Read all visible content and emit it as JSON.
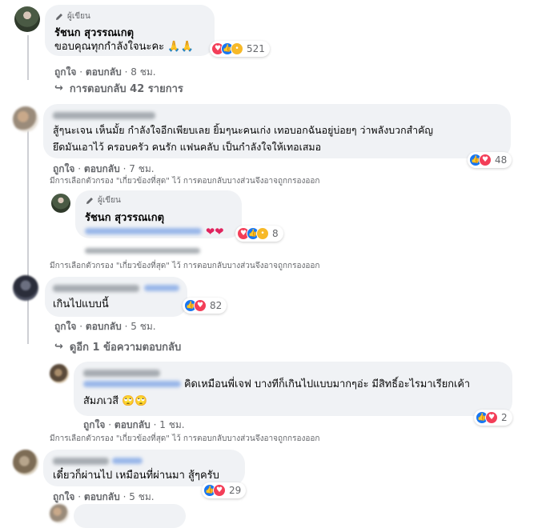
{
  "comments": [
    {
      "author_tag": "ผู้เขียน",
      "name": "รัชนก สุวรรณเกตุ",
      "text": "ขอบคุณทุกกำลังใจนะคะ 🙏🙏",
      "reaction_count": "521",
      "like_label": "ถูกใจ",
      "reply_label": "ตอบกลับ",
      "time": "8 ชม.",
      "replies_label": "การตอบกลับ 42 รายการ"
    },
    {
      "text_line1": "สู้ๆนะเจน เห็นมั้ย กำลังใจอีกเพียบเลย ยิ้มๆนะคนเก่ง เทอบอกฉันอยู่บ่อยๆ ว่าพลังบวกสำคัญ",
      "text_line2": "ยึดมันเอาไว้ ครอบครัว คนรัก แฟนคลับ เป็นกำลังใจให้เทอเสมอ",
      "reaction_count": "48",
      "like_label": "ถูกใจ",
      "reply_label": "ตอบกลับ",
      "time": "7 ชม.",
      "filter_note": "มีการเลือกตัวกรอง \"เกี่ยวข้องที่สุด\" ไว้ การตอบกลับบางส่วนจึงอาจถูกกรองออก"
    },
    {
      "author_tag": "ผู้เขียน",
      "name": "รัชนก สุวรรณเกตุ",
      "text": "❤❤",
      "reaction_count": "8",
      "filter_note": "มีการเลือกตัวกรอง \"เกี่ยวข้องที่สุด\" ไว้ การตอบกลับบางส่วนจึงอาจถูกกรองออก"
    },
    {
      "text": "เกินไปแบบนี้",
      "reaction_count": "82",
      "like_label": "ถูกใจ",
      "reply_label": "ตอบกลับ",
      "time": "5 ชม.",
      "replies_label": "ดูอีก 1 ข้อความตอบกลับ"
    },
    {
      "text_line1": "คิดเหมือนพี่เจฟ บางทีก็เกินไปแบบมากๆอ่ะ มีสิทธิ์อะไรมาเรียกเค้า",
      "text_line2": "สัมภเวสี 🙄🙄",
      "reaction_count": "2",
      "like_label": "ถูกใจ",
      "reply_label": "ตอบกลับ",
      "time": "1 ชม.",
      "filter_note": "มีการเลือกตัวกรอง \"เกี่ยวข้องที่สุด\" ไว้ การตอบกลับบางส่วนจึงอาจถูกกรองออก"
    },
    {
      "text": "เดี๋ยวก็ผ่านไป เหมือนที่ผ่านมา สู้ๆครับ",
      "reaction_count": "29",
      "like_label": "ถูกใจ",
      "reply_label": "ตอบกลับ",
      "time": "5 ชม."
    }
  ],
  "separator": "·",
  "colors": {
    "bubble": "#f0f2f5",
    "like": "#1877f2",
    "love": "#f33e58",
    "care": "#f7b928",
    "muted": "#65676b"
  }
}
